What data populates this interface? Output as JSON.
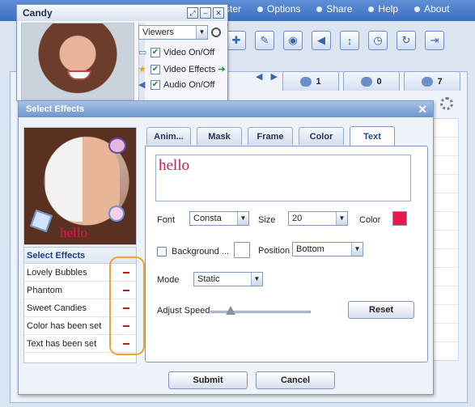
{
  "app": {
    "menu": [
      "ster",
      "Options",
      "Share",
      "Help",
      "About"
    ],
    "toolbar_icons": [
      "gamepad-icon",
      "edit-icon",
      "webcam-icon",
      "speaker-icon",
      "volume-slider-icon",
      "history-icon",
      "redo-icon",
      "logout-icon"
    ],
    "tabs": [
      {
        "count": "1",
        "icon": "contacts-icon"
      },
      {
        "count": "0",
        "icon": "group-icon"
      },
      {
        "count": "7",
        "icon": "chat-icon"
      }
    ]
  },
  "candy": {
    "title": "Candy",
    "viewer_select": "Viewers",
    "options": [
      {
        "label": "Video On/Off",
        "checked": true
      },
      {
        "label": "Video Effects",
        "checked": true
      },
      {
        "label": "Audio On/Off",
        "checked": true
      }
    ]
  },
  "dialog": {
    "title": "Select Effects",
    "preview_text": "hello",
    "effects_header": "Select Effects",
    "effects": [
      "Lovely Bubbles",
      "Phantom",
      "Sweet Candies",
      "Color has been set",
      "Text has been set"
    ],
    "tabs": [
      "Anim...",
      "Mask",
      "Frame",
      "Color",
      "Text"
    ],
    "active_tab": "Text",
    "text_value": "hello",
    "font_label": "Font",
    "font_value": "Consta",
    "size_label": "Size",
    "size_value": "20",
    "color_label": "Color",
    "text_color": "#e8194e",
    "background_label": "Background ...",
    "position_label": "Position",
    "position_value": "Bottom",
    "mode_label": "Mode",
    "mode_value": "Static",
    "speed_label": "Adjust Speed",
    "speed_fraction": 0.2,
    "reset_label": "Reset",
    "submit_label": "Submit",
    "cancel_label": "Cancel"
  }
}
